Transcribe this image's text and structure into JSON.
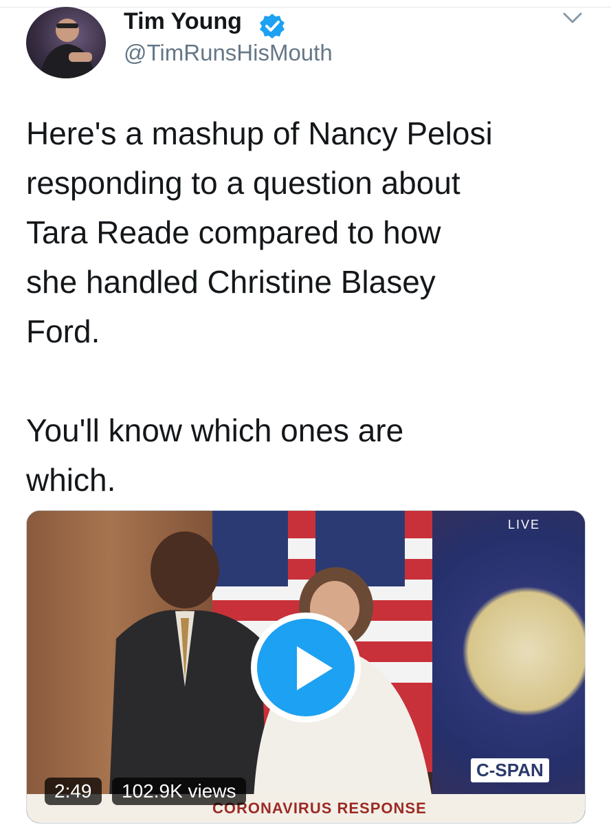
{
  "tweet": {
    "author_name": "Tim Young",
    "handle": "@TimRunsHisMouth",
    "paragraphs": [
      "Here's a mashup of Nancy Pelosi\nresponding to a question about\nTara Reade compared to how\nshe handled Christine Blasey\nFord.",
      "You'll know which ones are\nwhich."
    ]
  },
  "media": {
    "duration": "2:49",
    "views": "102.9K views",
    "live_label": "LIVE",
    "network_label": "C-SPAN",
    "lower_third": "CORONAVIRUS RESPONSE"
  },
  "colors": {
    "verified": "#1da1f2",
    "play_button": "#1da1f2",
    "handle_gray": "#657786"
  },
  "icons": {
    "verified": "verified-badge-icon",
    "menu": "chevron-down-icon",
    "play": "play-icon"
  }
}
